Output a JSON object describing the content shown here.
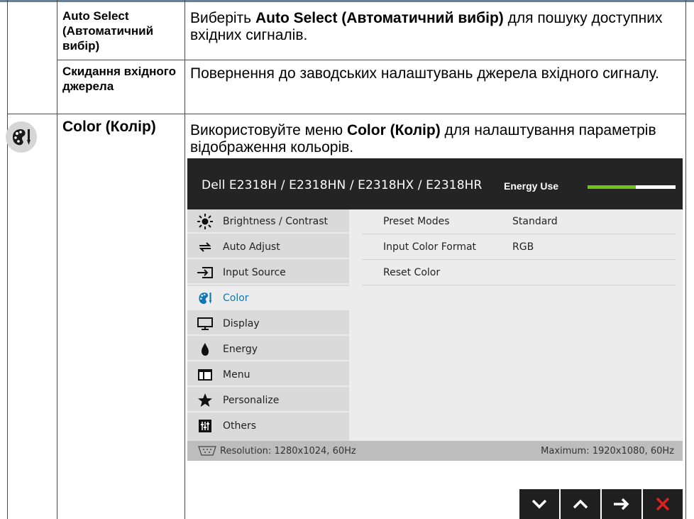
{
  "rows": [
    {
      "term": "Auto Select (Автоматичний вибір)",
      "desc_prefix": "Виберіть ",
      "desc_bold": "Auto Select (Автоматичний вибір)",
      "desc_suffix": " для пошуку доступних вхідних сигналів."
    },
    {
      "term": "Скидання вхідного джерела",
      "desc": "Повернення до заводських налаштувань джерела вхідного сигналу."
    },
    {
      "term": "Color (Колір)",
      "icon": "color-palette-icon",
      "desc_prefix": "Використовуйте меню ",
      "desc_bold": "Color (Колір)",
      "desc_suffix": " для налаштування параметрів відображення кольорів."
    }
  ],
  "osd": {
    "model": "Dell E2318H / E2318HN / E2318HX / E2318HR",
    "energy_label": "Energy Use",
    "energy_level": 0.55,
    "menu": [
      {
        "label": "Brightness / Contrast",
        "icon": "sun-icon"
      },
      {
        "label": "Auto Adjust",
        "icon": "auto-adjust-icon"
      },
      {
        "label": "Input Source",
        "icon": "input-source-icon"
      },
      {
        "label": "Color",
        "icon": "color-palette-icon",
        "active": true
      },
      {
        "label": "Display",
        "icon": "monitor-icon"
      },
      {
        "label": "Energy",
        "icon": "energy-icon"
      },
      {
        "label": "Menu",
        "icon": "menu-window-icon"
      },
      {
        "label": "Personalize",
        "icon": "star-icon"
      },
      {
        "label": "Others",
        "icon": "others-icon"
      }
    ],
    "settings": [
      {
        "label": "Preset Modes",
        "value": "Standard"
      },
      {
        "label": "Input Color Format",
        "value": "RGB"
      },
      {
        "label": "Reset Color",
        "value": ""
      }
    ],
    "footer": {
      "resolution": "Resolution: 1280x1024, 60Hz",
      "maximum": "Maximum: 1920x1080, 60Hz"
    },
    "buttons": [
      "down-arrow-icon",
      "up-arrow-icon",
      "right-arrow-icon",
      "close-icon"
    ],
    "colors": {
      "accent": "#0f78b4",
      "energy": "#6cc318",
      "exit": "#e02020"
    }
  }
}
